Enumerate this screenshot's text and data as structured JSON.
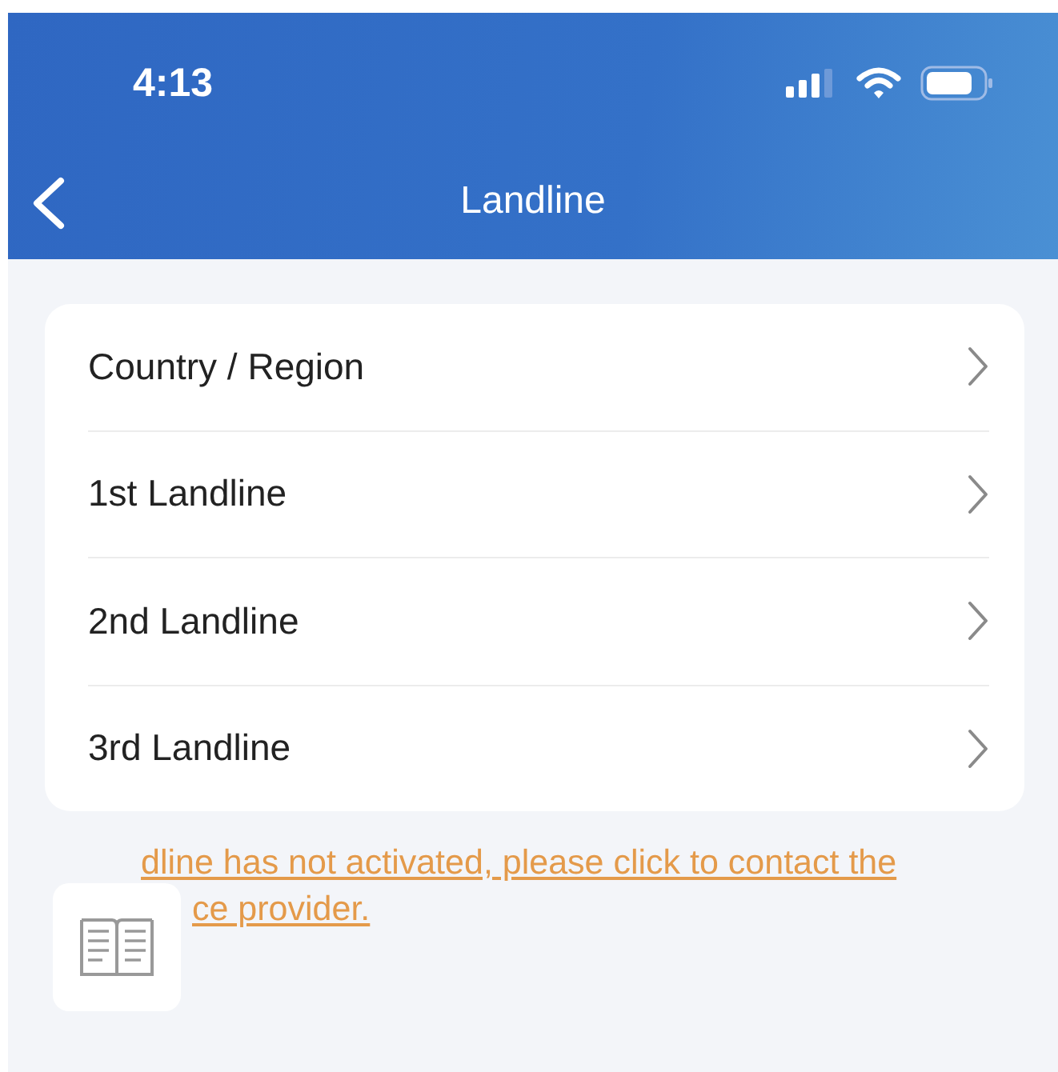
{
  "status_bar": {
    "time": "4:13"
  },
  "nav": {
    "title": "Landline"
  },
  "menu_items": [
    {
      "label": "Country / Region"
    },
    {
      "label": "1st Landline"
    },
    {
      "label": "2nd Landline"
    },
    {
      "label": "3rd Landline"
    }
  ],
  "notice": {
    "lines": [
      "dline has not activated, please click to contact the",
      "ce provider."
    ]
  }
}
